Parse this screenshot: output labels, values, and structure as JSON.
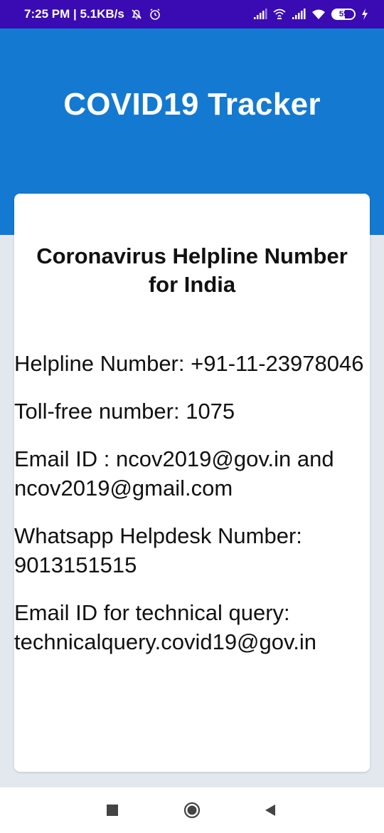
{
  "status_bar": {
    "time_speed": "7:25 PM | 5.1KB/s",
    "battery_level": "55",
    "background": "#3a0bb3"
  },
  "header": {
    "title": "COVID19 Tracker",
    "color": "#1479d1"
  },
  "card": {
    "title": "Coronavirus Helpline Number for India",
    "items": [
      {
        "text": "Helpline Number: +91-11-23978046"
      },
      {
        "text": "Toll-free number: 1075"
      },
      {
        "text": "Email ID : ncov2019@gov.in and ncov2019@gmail.com"
      },
      {
        "text": "Whatsapp Helpdesk Number: 9013151515"
      },
      {
        "text": "Email ID for technical query: technicalquery.covid19@gov.in"
      }
    ]
  },
  "nav_bar": {
    "icons": [
      "recent-apps-icon",
      "home-icon",
      "back-icon"
    ]
  }
}
